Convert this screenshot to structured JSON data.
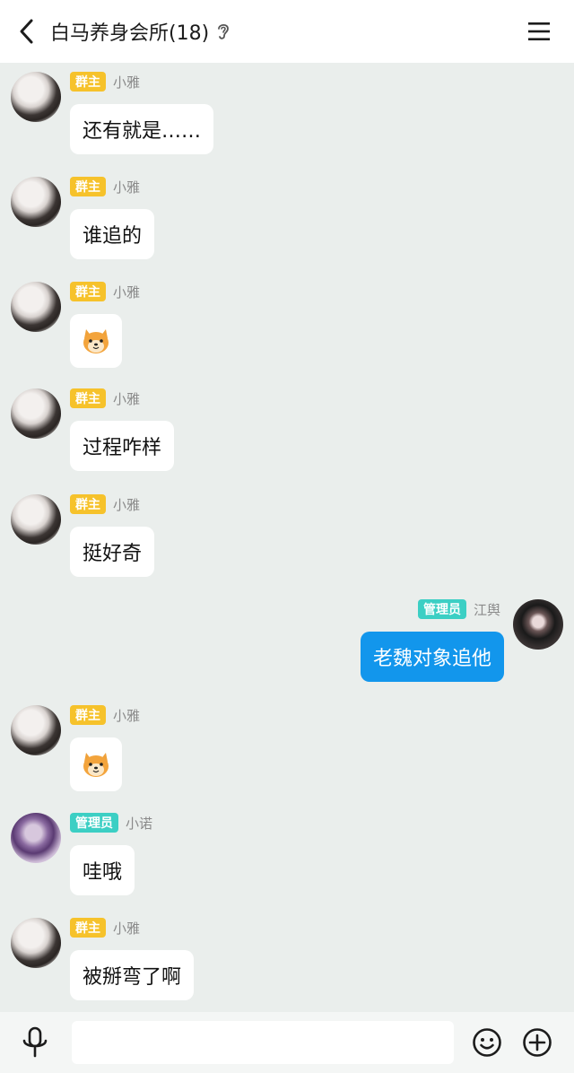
{
  "header": {
    "title": "白马养身会所(18)",
    "back_icon": "chevron-left-icon",
    "ear_icon": "ear-icon",
    "menu_icon": "hamburger-menu-icon"
  },
  "messages": [
    {
      "badge": "群主",
      "name": "小雅",
      "text": "还有就是……"
    },
    {
      "badge": "群主",
      "name": "小雅",
      "text": "谁追的"
    },
    {
      "badge": "群主",
      "name": "小雅",
      "sticker": "shiba-dog-sticker"
    },
    {
      "badge": "群主",
      "name": "小雅",
      "text": "过程咋样"
    },
    {
      "badge": "群主",
      "name": "小雅",
      "text": "挺好奇"
    },
    {
      "badge": "管理员",
      "name": "江舆",
      "text": "老魏对象追他"
    },
    {
      "badge": "群主",
      "name": "小雅",
      "sticker": "shiba-dog-sticker"
    },
    {
      "badge": "管理员",
      "name": "小诺",
      "text": "哇哦"
    },
    {
      "badge": "群主",
      "name": "小雅",
      "text": "被掰弯了啊"
    }
  ],
  "input_bar": {
    "placeholder": "",
    "mic_icon": "microphone-icon",
    "emoji_icon": "smiley-icon",
    "plus_icon": "plus-circle-icon"
  },
  "colors": {
    "owner_badge": "#f6c22b",
    "admin_badge": "#3ccfc4",
    "outgoing_bubble": "#1296ec",
    "chat_background": "#eaeeec"
  }
}
